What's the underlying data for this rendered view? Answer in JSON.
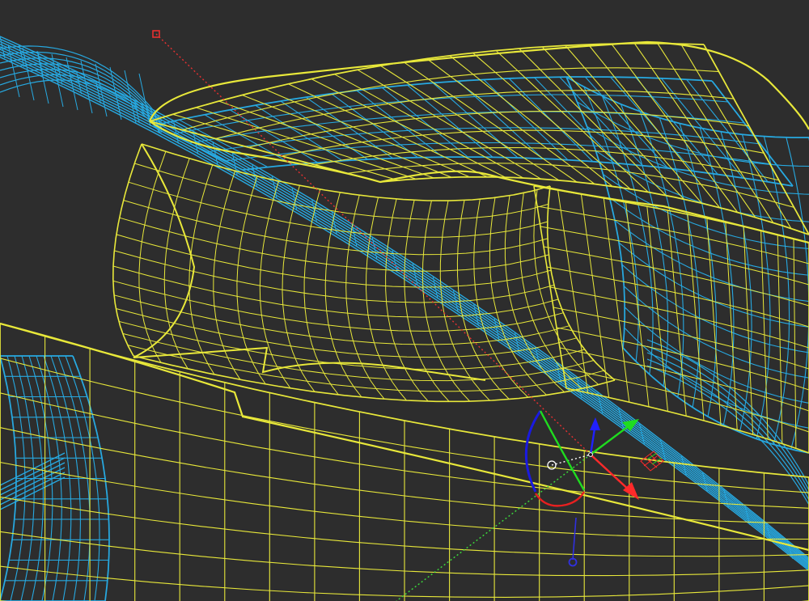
{
  "viewport": {
    "mode": "wireframe",
    "background": "#2d2d2d"
  },
  "colors": {
    "surface_yellow": "#e8e83a",
    "surface_blue": "#27a9e1",
    "axis_x": "#ff2a2a",
    "axis_y": "#1fdc1f",
    "axis_z": "#2020ff",
    "rotate_arc_blue": "#1a1ae0",
    "rotate_arc_green": "#1fdc1f",
    "rotate_arc_red": "#e82020",
    "guide_red": "#e83030",
    "guide_green": "#3ce03c",
    "guide_blue": "#3030e0",
    "pivot_white": "#ffffff"
  },
  "gizmo": {
    "type": "transform-manipulator",
    "handles": [
      "move-x-arrow",
      "move-y-arrow",
      "move-z-arrow",
      "rotate-x-arc",
      "rotate-y-arc",
      "rotate-z-arc",
      "pivot-point",
      "view-center-circle",
      "planar-move-square"
    ]
  },
  "objects": [
    {
      "name": "wing-surface-yellow",
      "kind": "nurbs-surface",
      "color": "yellow"
    },
    {
      "name": "fillet-surface-yellow",
      "kind": "nurbs-surface",
      "color": "yellow"
    },
    {
      "name": "lower-panel-yellow",
      "kind": "nurbs-surface",
      "color": "yellow"
    },
    {
      "name": "body-surface-blue",
      "kind": "nurbs-surface",
      "color": "blue"
    },
    {
      "name": "beam-surface-blue",
      "kind": "nurbs-surface",
      "color": "blue"
    }
  ]
}
